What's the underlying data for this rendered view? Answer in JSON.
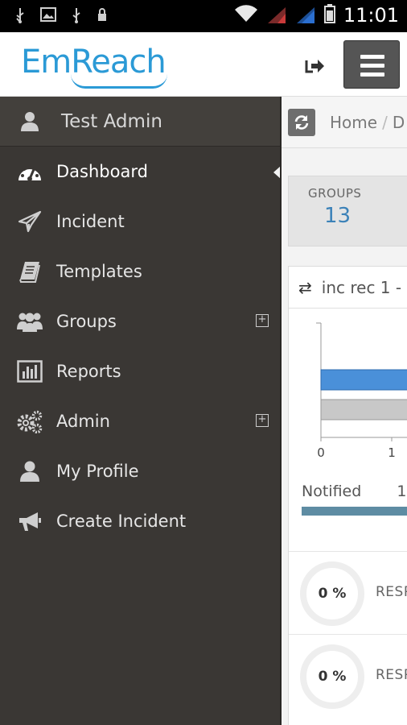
{
  "status_bar": {
    "time": "11:01",
    "left_icons": [
      "usb-icon",
      "image-icon",
      "usb-icon",
      "lock-icon"
    ],
    "right_icons": [
      "wifi-icon",
      "signal-icon",
      "signal-icon",
      "battery-icon"
    ]
  },
  "app": {
    "logo_text": "EmReach",
    "brand_color": "#2b9ad6"
  },
  "header": {
    "logout_icon": "logout-icon",
    "menu_icon": "hamburger-icon"
  },
  "sidebar": {
    "user_name": "Test Admin",
    "items": [
      {
        "label": "Dashboard",
        "icon": "dashboard-icon",
        "active": true,
        "expandable": false
      },
      {
        "label": "Incident",
        "icon": "paper-plane-icon",
        "active": false,
        "expandable": false
      },
      {
        "label": "Templates",
        "icon": "book-icon",
        "active": false,
        "expandable": false
      },
      {
        "label": "Groups",
        "icon": "users-icon",
        "active": false,
        "expandable": true
      },
      {
        "label": "Reports",
        "icon": "bar-chart-icon",
        "active": false,
        "expandable": false
      },
      {
        "label": "Admin",
        "icon": "gears-icon",
        "active": false,
        "expandable": true
      },
      {
        "label": "My Profile",
        "icon": "user-icon",
        "active": false,
        "expandable": false
      },
      {
        "label": "Create Incident",
        "icon": "megaphone-icon",
        "active": false,
        "expandable": false
      }
    ],
    "expand_glyph": "+"
  },
  "main": {
    "breadcrumb": {
      "home": "Home",
      "separator": "/",
      "current": "D"
    },
    "groups_card": {
      "label": "GROUPS",
      "value": "13"
    },
    "panel": {
      "title": "inc rec 1 -",
      "notified_label": "Notified",
      "notified_value": "1",
      "responses": [
        {
          "percent": "0 %",
          "label": "RESP"
        },
        {
          "percent": "0 %",
          "label": "RESP"
        }
      ]
    }
  },
  "chart_data": {
    "type": "bar",
    "orientation": "horizontal",
    "categories": [
      "",
      ""
    ],
    "series": [
      {
        "values": [
          2
        ],
        "color": "#4a90d9"
      },
      {
        "values": [
          2
        ],
        "color": "#c8c8c8"
      }
    ],
    "x_ticks": [
      "0",
      "1"
    ],
    "xlim": [
      0,
      1.1
    ],
    "grid": false
  }
}
